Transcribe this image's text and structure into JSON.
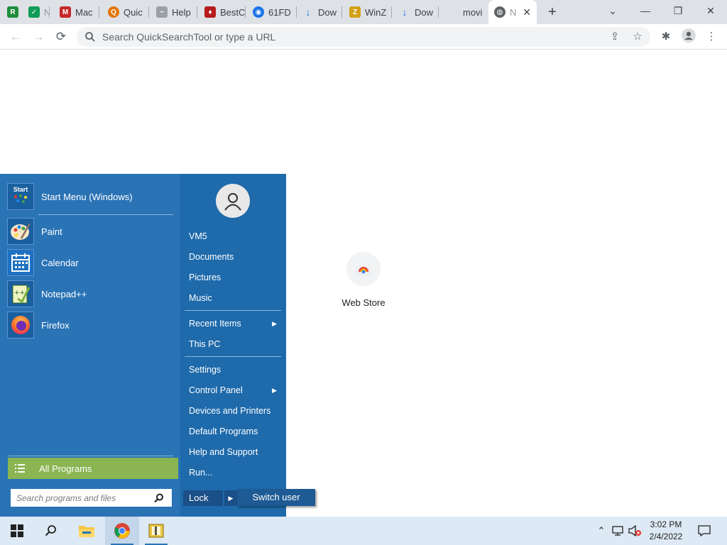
{
  "browser": {
    "tabs": [
      {
        "label": "",
        "color": "#1e8e3e",
        "glyph": "R"
      },
      {
        "label": "N",
        "color": "#0f9d58",
        "glyph": "✓"
      },
      {
        "label": "Mac",
        "color": "#c62828",
        "glyph": "M"
      },
      {
        "label": "Quic",
        "color": "#e37400",
        "glyph": "Q"
      },
      {
        "label": "Help",
        "color": "#9aa0a6",
        "glyph": "~"
      },
      {
        "label": "BestC",
        "color": "#b71c1c",
        "glyph": "♦"
      },
      {
        "label": "61FD",
        "color": "#1a73e8",
        "glyph": "◉"
      },
      {
        "label": "Dow",
        "color": "#1a73e8",
        "glyph": "↓"
      },
      {
        "label": "WinZ",
        "color": "#d4a017",
        "glyph": "Z"
      },
      {
        "label": "Dow",
        "color": "#1a73e8",
        "glyph": "↓"
      },
      {
        "label": "movi",
        "color": "",
        "glyph": ""
      },
      {
        "label": "N",
        "color": "#5f6368",
        "glyph": "◍",
        "active": true
      }
    ],
    "new_tab": "+",
    "window_controls": {
      "minimize": "—",
      "restore": "❐",
      "close": "✕",
      "dropdown": "⌄"
    },
    "address_placeholder": "Search QuickSearchTool or type a URL"
  },
  "new_tab_page": {
    "shortcut_label": "Web Store"
  },
  "start_menu": {
    "pinned": [
      {
        "label": "Start Menu (Windows)",
        "icon": "start-menu-icon"
      },
      {
        "label": "Paint",
        "icon": "paint-icon"
      },
      {
        "label": "Calendar",
        "icon": "calendar-icon"
      },
      {
        "label": "Notepad++",
        "icon": "notepad-plus-plus-icon"
      },
      {
        "label": "Firefox",
        "icon": "firefox-icon"
      }
    ],
    "start_icon_text": "Start",
    "all_programs": "All Programs",
    "search_placeholder": "Search programs and files",
    "right_links": {
      "user": "VM5",
      "documents": "Documents",
      "pictures": "Pictures",
      "music": "Music",
      "recent_items": "Recent Items",
      "this_pc": "This PC",
      "settings": "Settings",
      "control_panel": "Control Panel",
      "devices_printers": "Devices and Printers",
      "default_programs": "Default Programs",
      "help_support": "Help and Support",
      "run": "Run..."
    },
    "lock": "Lock",
    "switch_user": "Switch user"
  },
  "taskbar": {
    "time": "3:02 PM",
    "date": "2/4/2022"
  }
}
